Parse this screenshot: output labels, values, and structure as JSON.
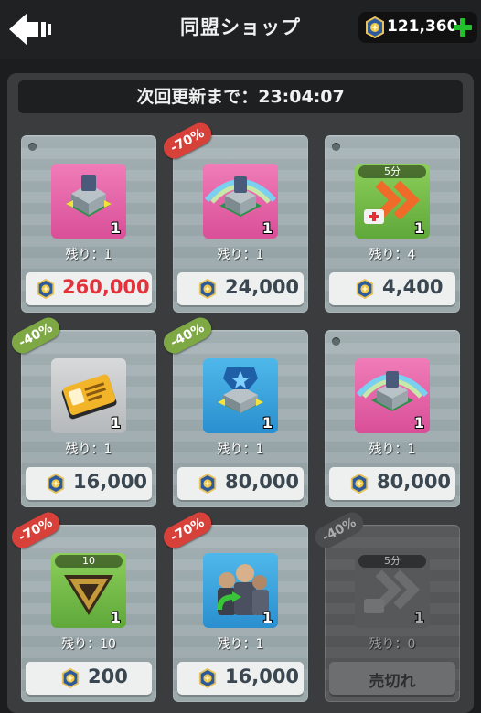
{
  "header": {
    "title": "同盟ショップ",
    "currency_amount": "121,360",
    "back_icon": "back-arrow-icon",
    "plus_icon": "plus-icon"
  },
  "timer": {
    "label": "次回更新まで：23:04:07"
  },
  "colors": {
    "accent_green": "#22c02a",
    "price_red": "#e4323d",
    "badge_red": "#d8413a",
    "badge_green": "#7ea843"
  },
  "items": [
    {
      "name": "pink-tower-radar",
      "qty": "1",
      "remaining": "残り：1",
      "price": "260,000",
      "badge": "",
      "duration": ""
    },
    {
      "name": "rainbow-tower",
      "qty": "1",
      "remaining": "残り：1",
      "price": "24,000",
      "badge": "-70%",
      "duration": ""
    },
    {
      "name": "speed-boost-medkit",
      "qty": "1",
      "remaining": "残り：4",
      "price": "4,400",
      "badge": "",
      "duration": "5分"
    },
    {
      "name": "id-card",
      "qty": "1",
      "remaining": "残り：1",
      "price": "16,000",
      "badge": "-40%",
      "duration": ""
    },
    {
      "name": "blue-star-tower",
      "qty": "1",
      "remaining": "残り：1",
      "price": "80,000",
      "badge": "-40%",
      "duration": ""
    },
    {
      "name": "rainbow-tower-2",
      "qty": "1",
      "remaining": "残り：1",
      "price": "80,000",
      "badge": "",
      "duration": ""
    },
    {
      "name": "rank-chevron",
      "qty": "1",
      "remaining": "残り：10",
      "price": "200",
      "badge": "-70%",
      "duration": "10"
    },
    {
      "name": "soldier-swap",
      "qty": "1",
      "remaining": "残り：1",
      "price": "16,000",
      "badge": "-70%",
      "duration": ""
    },
    {
      "name": "speed-boost-soldout",
      "qty": "1",
      "remaining": "残り：0",
      "price": "売切れ",
      "badge": "-40%",
      "duration": "5分"
    }
  ]
}
